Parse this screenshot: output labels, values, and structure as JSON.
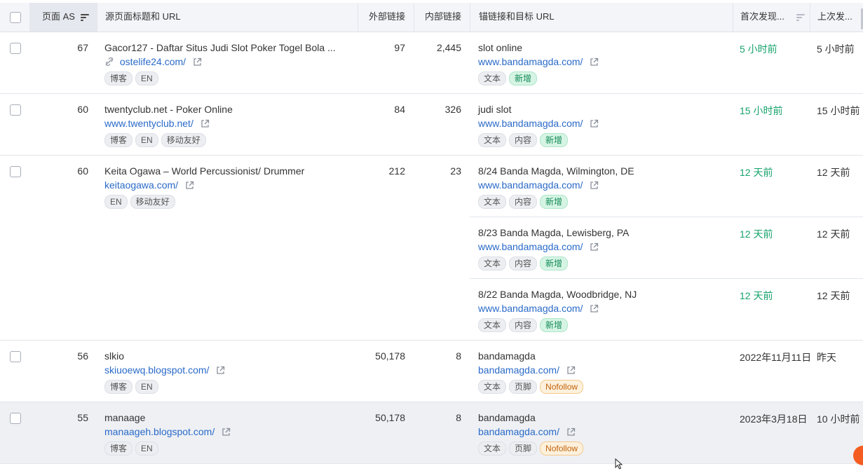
{
  "header": {
    "col_page_as": "页面 AS",
    "col_source": "源页面标题和 URL",
    "col_external": "外部链接",
    "col_internal": "内部链接",
    "col_anchor": "锚链接和目标 URL",
    "col_first_seen": "首次发现...",
    "col_last_seen": "上次发..."
  },
  "rows": [
    {
      "as": "67",
      "title": "Gacor127 - Daftar Situs Judi Slot Poker Togel Bola ...",
      "url": "ostelife24.com/",
      "broken_link_icon": "broken-link-icon",
      "tags": [
        "博客",
        "EN"
      ],
      "external": "97",
      "internal": "2,445",
      "links": [
        {
          "anchor": "slot online",
          "target": "www.bandamagda.com/",
          "tags": [
            "文本"
          ],
          "new_tag": "新增",
          "first": "5 小时前",
          "last": "5 小时前"
        }
      ]
    },
    {
      "as": "60",
      "title": "twentyclub.net - Poker Online",
      "url": "www.twentyclub.net/",
      "tags": [
        "博客",
        "EN",
        "移动友好"
      ],
      "external": "84",
      "internal": "326",
      "links": [
        {
          "anchor": "judi slot",
          "target": "www.bandamagda.com/",
          "tags": [
            "文本",
            "内容"
          ],
          "new_tag": "新增",
          "first": "15 小时前",
          "last": "15 小时前"
        }
      ]
    },
    {
      "as": "60",
      "title": "Keita Ogawa – World Percussionist/ Drummer",
      "url": "keitaogawa.com/",
      "tags": [
        "EN",
        "移动友好"
      ],
      "external": "212",
      "internal": "23",
      "links": [
        {
          "anchor": "8/24 Banda Magda, Wilmington, DE",
          "target": "www.bandamagda.com/",
          "tags": [
            "文本",
            "内容"
          ],
          "new_tag": "新增",
          "first": "12 天前",
          "last": "12 天前"
        },
        {
          "anchor": "8/23 Banda Magda, Lewisberg, PA",
          "target": "www.bandamagda.com/",
          "tags": [
            "文本",
            "内容"
          ],
          "new_tag": "新增",
          "first": "12 天前",
          "last": "12 天前"
        },
        {
          "anchor": "8/22 Banda Magda, Woodbridge, NJ",
          "target": "www.bandamagda.com/",
          "tags": [
            "文本",
            "内容"
          ],
          "new_tag": "新增",
          "first": "12 天前",
          "last": "12 天前"
        }
      ]
    },
    {
      "as": "56",
      "title": "slkio",
      "url": "skiuoewq.blogspot.com/",
      "tags": [
        "博客",
        "EN"
      ],
      "external": "50,178",
      "internal": "8",
      "links": [
        {
          "anchor": "bandamagda",
          "target": "bandamagda.com/",
          "tags": [
            "文本",
            "页脚"
          ],
          "nofollow_tag": "Nofollow",
          "first": "2022年11月11日",
          "last": "昨天"
        }
      ]
    },
    {
      "as": "55",
      "title": "manaage",
      "url": "manaageh.blogspot.com/",
      "tags": [
        "博客",
        "EN"
      ],
      "external": "50,178",
      "internal": "8",
      "links": [
        {
          "anchor": "bandamagda",
          "target": "bandamagda.com/",
          "tags": [
            "文本",
            "页脚"
          ],
          "nofollow_tag": "Nofollow",
          "first": "2023年3月18日",
          "last": "10 小时前"
        }
      ]
    }
  ],
  "colors": {
    "link": "#2a6ac8",
    "green": "#16a36b",
    "new_bg": "#d6f4e4",
    "nofollow_bg": "#fdf1dd"
  }
}
